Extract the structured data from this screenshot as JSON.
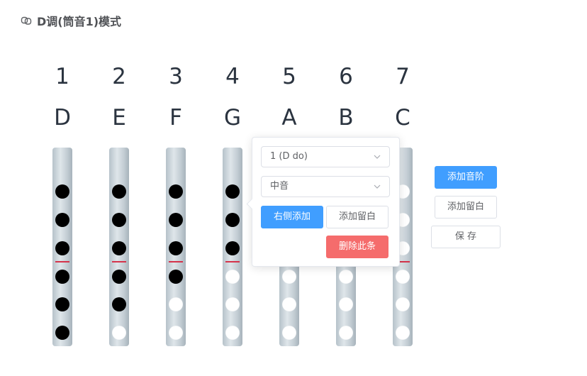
{
  "header": {
    "title": "D调(筒音1)模式",
    "icon": "link-icon"
  },
  "columns": [
    {
      "number": "1",
      "note": "D",
      "holes": [
        true,
        true,
        true,
        true,
        true,
        true
      ]
    },
    {
      "number": "2",
      "note": "E",
      "holes": [
        true,
        true,
        true,
        true,
        true,
        false
      ]
    },
    {
      "number": "3",
      "note": "F",
      "holes": [
        true,
        true,
        true,
        true,
        false,
        false
      ]
    },
    {
      "number": "4",
      "note": "G",
      "holes": [
        true,
        true,
        true,
        false,
        false,
        false
      ]
    },
    {
      "number": "5",
      "note": "A",
      "holes": [
        false,
        false,
        false,
        false,
        false,
        false
      ]
    },
    {
      "number": "6",
      "note": "B",
      "holes": [
        false,
        false,
        false,
        false,
        false,
        false
      ]
    },
    {
      "number": "7",
      "note": "C",
      "holes": [
        false,
        false,
        false,
        false,
        false,
        false
      ]
    }
  ],
  "popover": {
    "scale_select": "1 (D do)",
    "register_select": "中音",
    "add_right_label": "右侧添加",
    "add_rest_label": "添加留白",
    "delete_label": "删除此条"
  },
  "actions": {
    "add_scale_label": "添加音阶",
    "add_rest_label": "添加留白",
    "save_label": "保 存"
  },
  "colors": {
    "primary": "#409eff",
    "danger": "#f56c6c",
    "thumb_mark": "#d5334b"
  }
}
